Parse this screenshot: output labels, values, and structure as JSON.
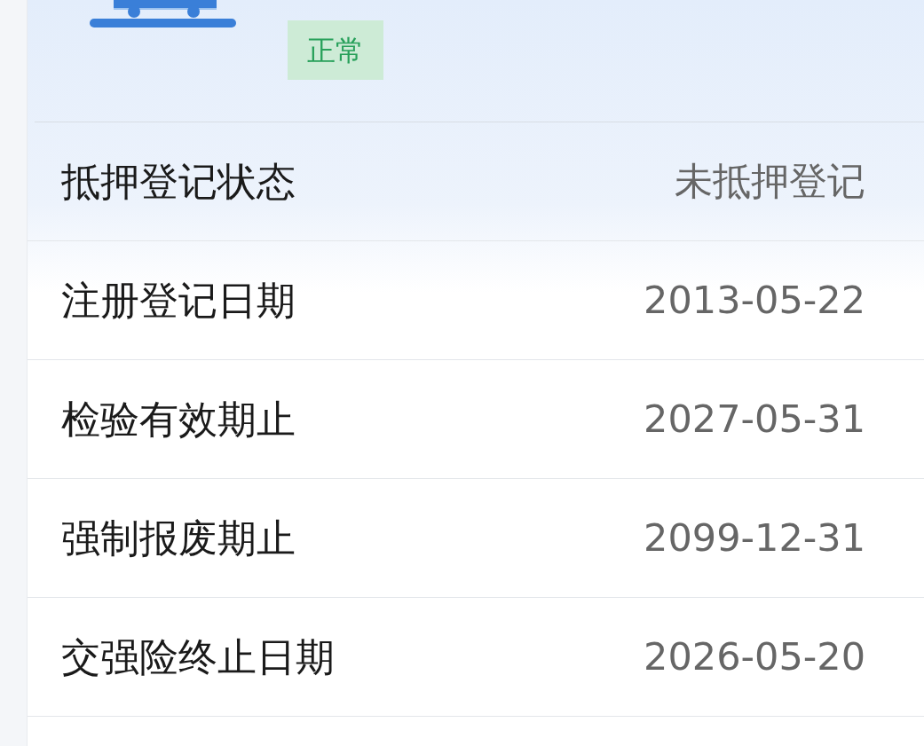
{
  "status_badge": "正常",
  "rows": [
    {
      "label": "抵押登记状态",
      "value": "未抵押登记"
    },
    {
      "label": "注册登记日期",
      "value": "2013-05-22"
    },
    {
      "label": "检验有效期止",
      "value": "2027-05-31"
    },
    {
      "label": "强制报废期止",
      "value": "2099-12-31"
    },
    {
      "label": "交强险终止日期",
      "value": "2026-05-20"
    }
  ]
}
